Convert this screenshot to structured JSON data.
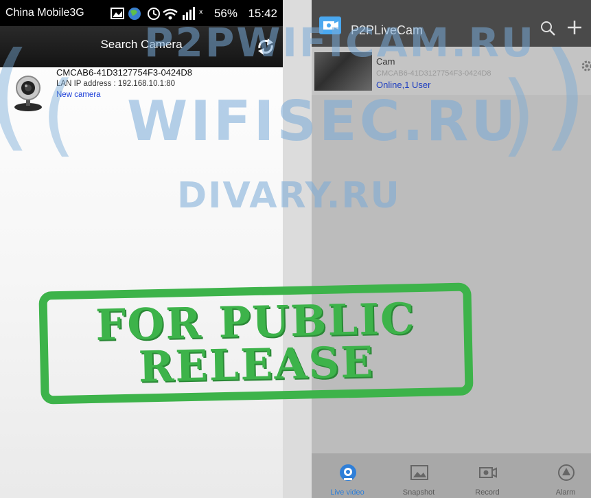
{
  "left_phone": {
    "status_bar": {
      "carrier": "China Mobile3G",
      "battery": "56%",
      "time": "15:42"
    },
    "title": "Search Camera",
    "results": [
      {
        "id": "CMCAB6-41D3127754F3-0424D8",
        "lan_ip": "LAN IP address : 192.168.10.1:80",
        "status": "New camera"
      }
    ]
  },
  "right_phone": {
    "app_title": "P2PLiveCam",
    "devices": [
      {
        "name": "Cam",
        "uid": "CMCAB6-41D3127754F3-0424D8",
        "status": "Online,1 User"
      }
    ],
    "tabs": [
      {
        "label": "Live video",
        "icon": "live-video-icon",
        "active": true
      },
      {
        "label": "Snapshot",
        "icon": "snapshot-icon",
        "active": false
      },
      {
        "label": "Record",
        "icon": "record-icon",
        "active": false
      },
      {
        "label": "Alarm",
        "icon": "alarm-icon",
        "active": false
      }
    ]
  },
  "watermarks": [
    "P2PWIFICAM.RU",
    "WIFISEC.RU",
    "DIVARY.RU"
  ],
  "stamp": {
    "line1": "FOR PUBLIC",
    "line2": "RELEASE"
  },
  "colors": {
    "stamp_green": "#3db34a",
    "watermark_blue": "#78aad7",
    "link_blue": "#1a3cd8",
    "active_tab_blue": "#2f7fd8"
  }
}
